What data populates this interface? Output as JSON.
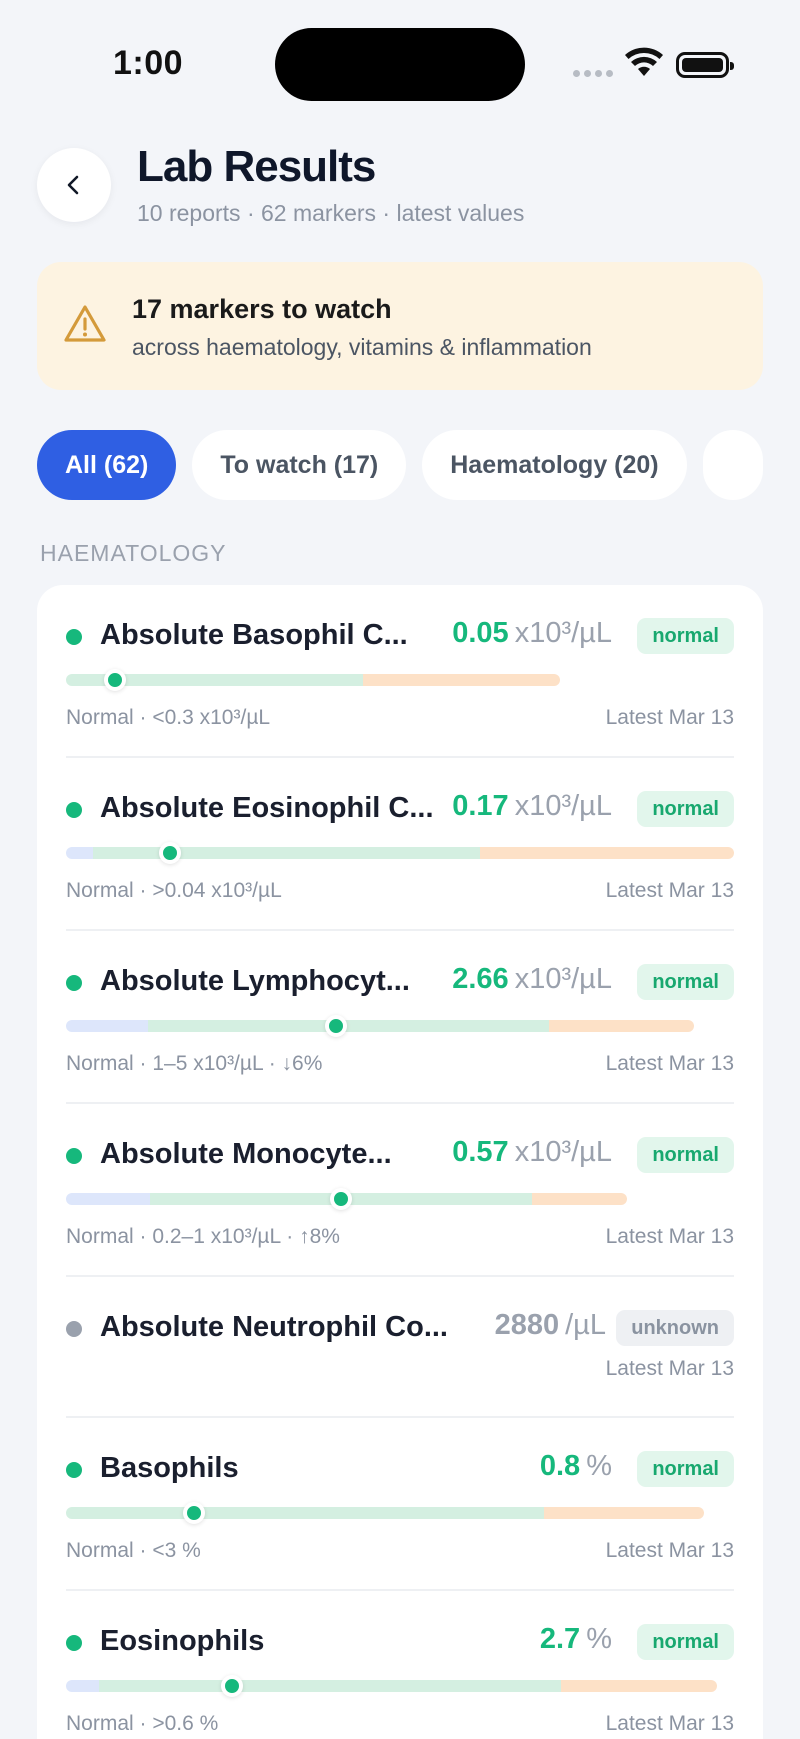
{
  "status_bar": {
    "time": "1:00"
  },
  "header": {
    "title": "Lab Results",
    "subtitle": "10 reports · 62 markers · latest values",
    "back_icon": "chevron-left-icon"
  },
  "alert": {
    "icon": "warning-triangle-icon",
    "title": "17 markers to watch",
    "description": "across haematology, vitamins & inflammation"
  },
  "filters": [
    {
      "label": "All (62)",
      "active": true
    },
    {
      "label": "To watch (17)",
      "active": false
    },
    {
      "label": "Haematology (20)",
      "active": false
    }
  ],
  "section": {
    "label": "HAEMATOLOGY"
  },
  "colors": {
    "normal": "#16b87c",
    "unknown": "#9aa1ad",
    "accent": "#2f5fe3",
    "low_range": "#dde6fb",
    "normal_range": "#d4efe1",
    "high_range": "#fde1c7"
  },
  "markers": [
    {
      "name": "Absolute Basophil C...",
      "value": "0.05",
      "unit": "x10³/µL",
      "status": "normal",
      "range_text": "Normal · <0.3 x10³/µL",
      "latest": "Latest Mar 13",
      "range": {
        "low": 0,
        "normal": 0.6,
        "high": 0.4,
        "bar_fraction": 0.74,
        "marker_pos": 0.1
      }
    },
    {
      "name": "Absolute Eosinophil C...",
      "value": "0.17",
      "unit": "x10³/µL",
      "status": "normal",
      "range_text": "Normal · >0.04 x10³/µL",
      "latest": "Latest Mar 13",
      "range": {
        "low": 0.04,
        "normal": 0.58,
        "high": 0.38,
        "bar_fraction": 1.0,
        "marker_pos": 0.155
      }
    },
    {
      "name": "Absolute Lymphocyt...",
      "value": "2.66",
      "unit": "x10³/µL",
      "status": "normal",
      "range_text": "Normal · 1–5 x10³/µL · ↓6%",
      "latest": "Latest Mar 13",
      "range": {
        "low": 0.13,
        "normal": 0.64,
        "high": 0.23,
        "bar_fraction": 0.94,
        "marker_pos": 0.43
      }
    },
    {
      "name": "Absolute Monocyte...",
      "value": "0.57",
      "unit": "x10³/µL",
      "status": "normal",
      "range_text": "Normal · 0.2–1 x10³/µL · ↑8%",
      "latest": "Latest Mar 13",
      "range": {
        "low": 0.15,
        "normal": 0.68,
        "high": 0.17,
        "bar_fraction": 0.84,
        "marker_pos": 0.49
      }
    },
    {
      "name": "Absolute Neutrophil Co...",
      "value": "2880",
      "unit": "/µL",
      "status": "unknown",
      "range_text": "",
      "latest": "Latest Mar 13",
      "range": null
    },
    {
      "name": "Basophils",
      "value": "0.8",
      "unit": "%",
      "status": "normal",
      "range_text": "Normal · <3 %",
      "latest": "Latest Mar 13",
      "range": {
        "low": 0,
        "normal": 0.75,
        "high": 0.25,
        "bar_fraction": 0.955,
        "marker_pos": 0.2
      }
    },
    {
      "name": "Eosinophils",
      "value": "2.7",
      "unit": "%",
      "status": "normal",
      "range_text": "Normal · >0.6 %",
      "latest": "Latest Mar 13",
      "range": {
        "low": 0.05,
        "normal": 0.71,
        "high": 0.24,
        "bar_fraction": 0.975,
        "marker_pos": 0.255
      }
    }
  ]
}
